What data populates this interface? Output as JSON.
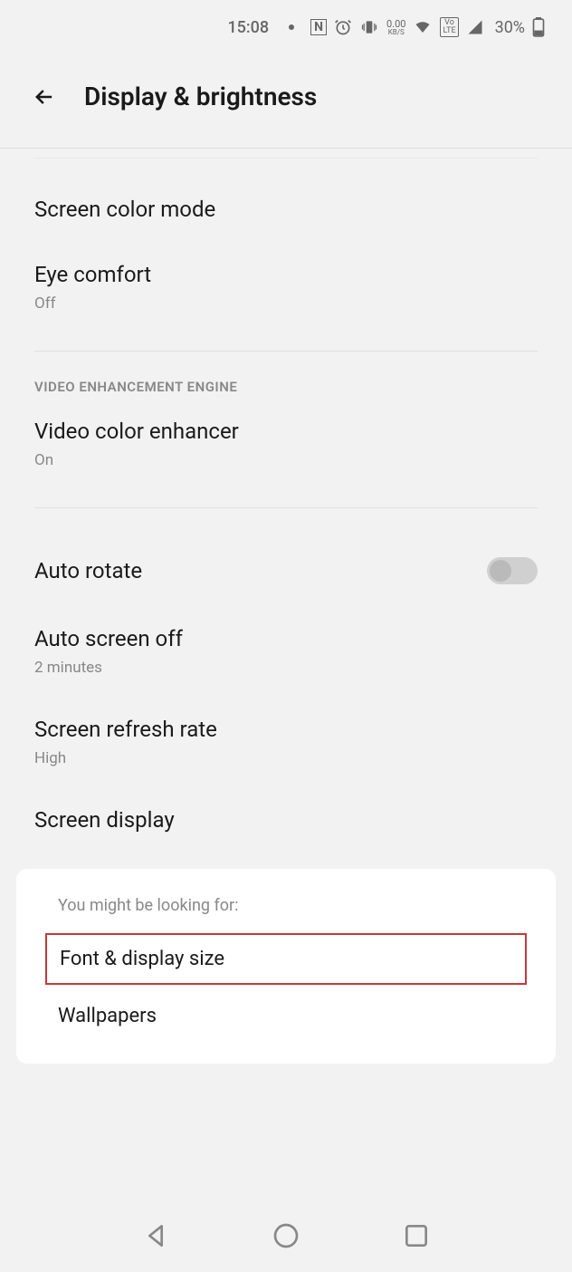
{
  "status": {
    "time": "15:08",
    "nfc_label": "N",
    "data_rate": "0.00",
    "data_unit": "KB/S",
    "lte_label": "VoLTE",
    "battery_pct": "30%"
  },
  "header": {
    "title": "Display & brightness"
  },
  "settings": {
    "screen_color_mode": {
      "title": "Screen color mode"
    },
    "eye_comfort": {
      "title": "Eye comfort",
      "subtitle": "Off"
    },
    "section_video": "VIDEO ENHANCEMENT ENGINE",
    "video_enhancer": {
      "title": "Video color enhancer",
      "subtitle": "On"
    },
    "auto_rotate": {
      "title": "Auto rotate"
    },
    "auto_screen_off": {
      "title": "Auto screen off",
      "subtitle": "2 minutes"
    },
    "refresh_rate": {
      "title": "Screen refresh rate",
      "subtitle": "High"
    },
    "screen_display": {
      "title": "Screen display"
    }
  },
  "suggestions": {
    "header": "You might be looking for:",
    "item1": "Font & display size",
    "item2": "Wallpapers"
  }
}
